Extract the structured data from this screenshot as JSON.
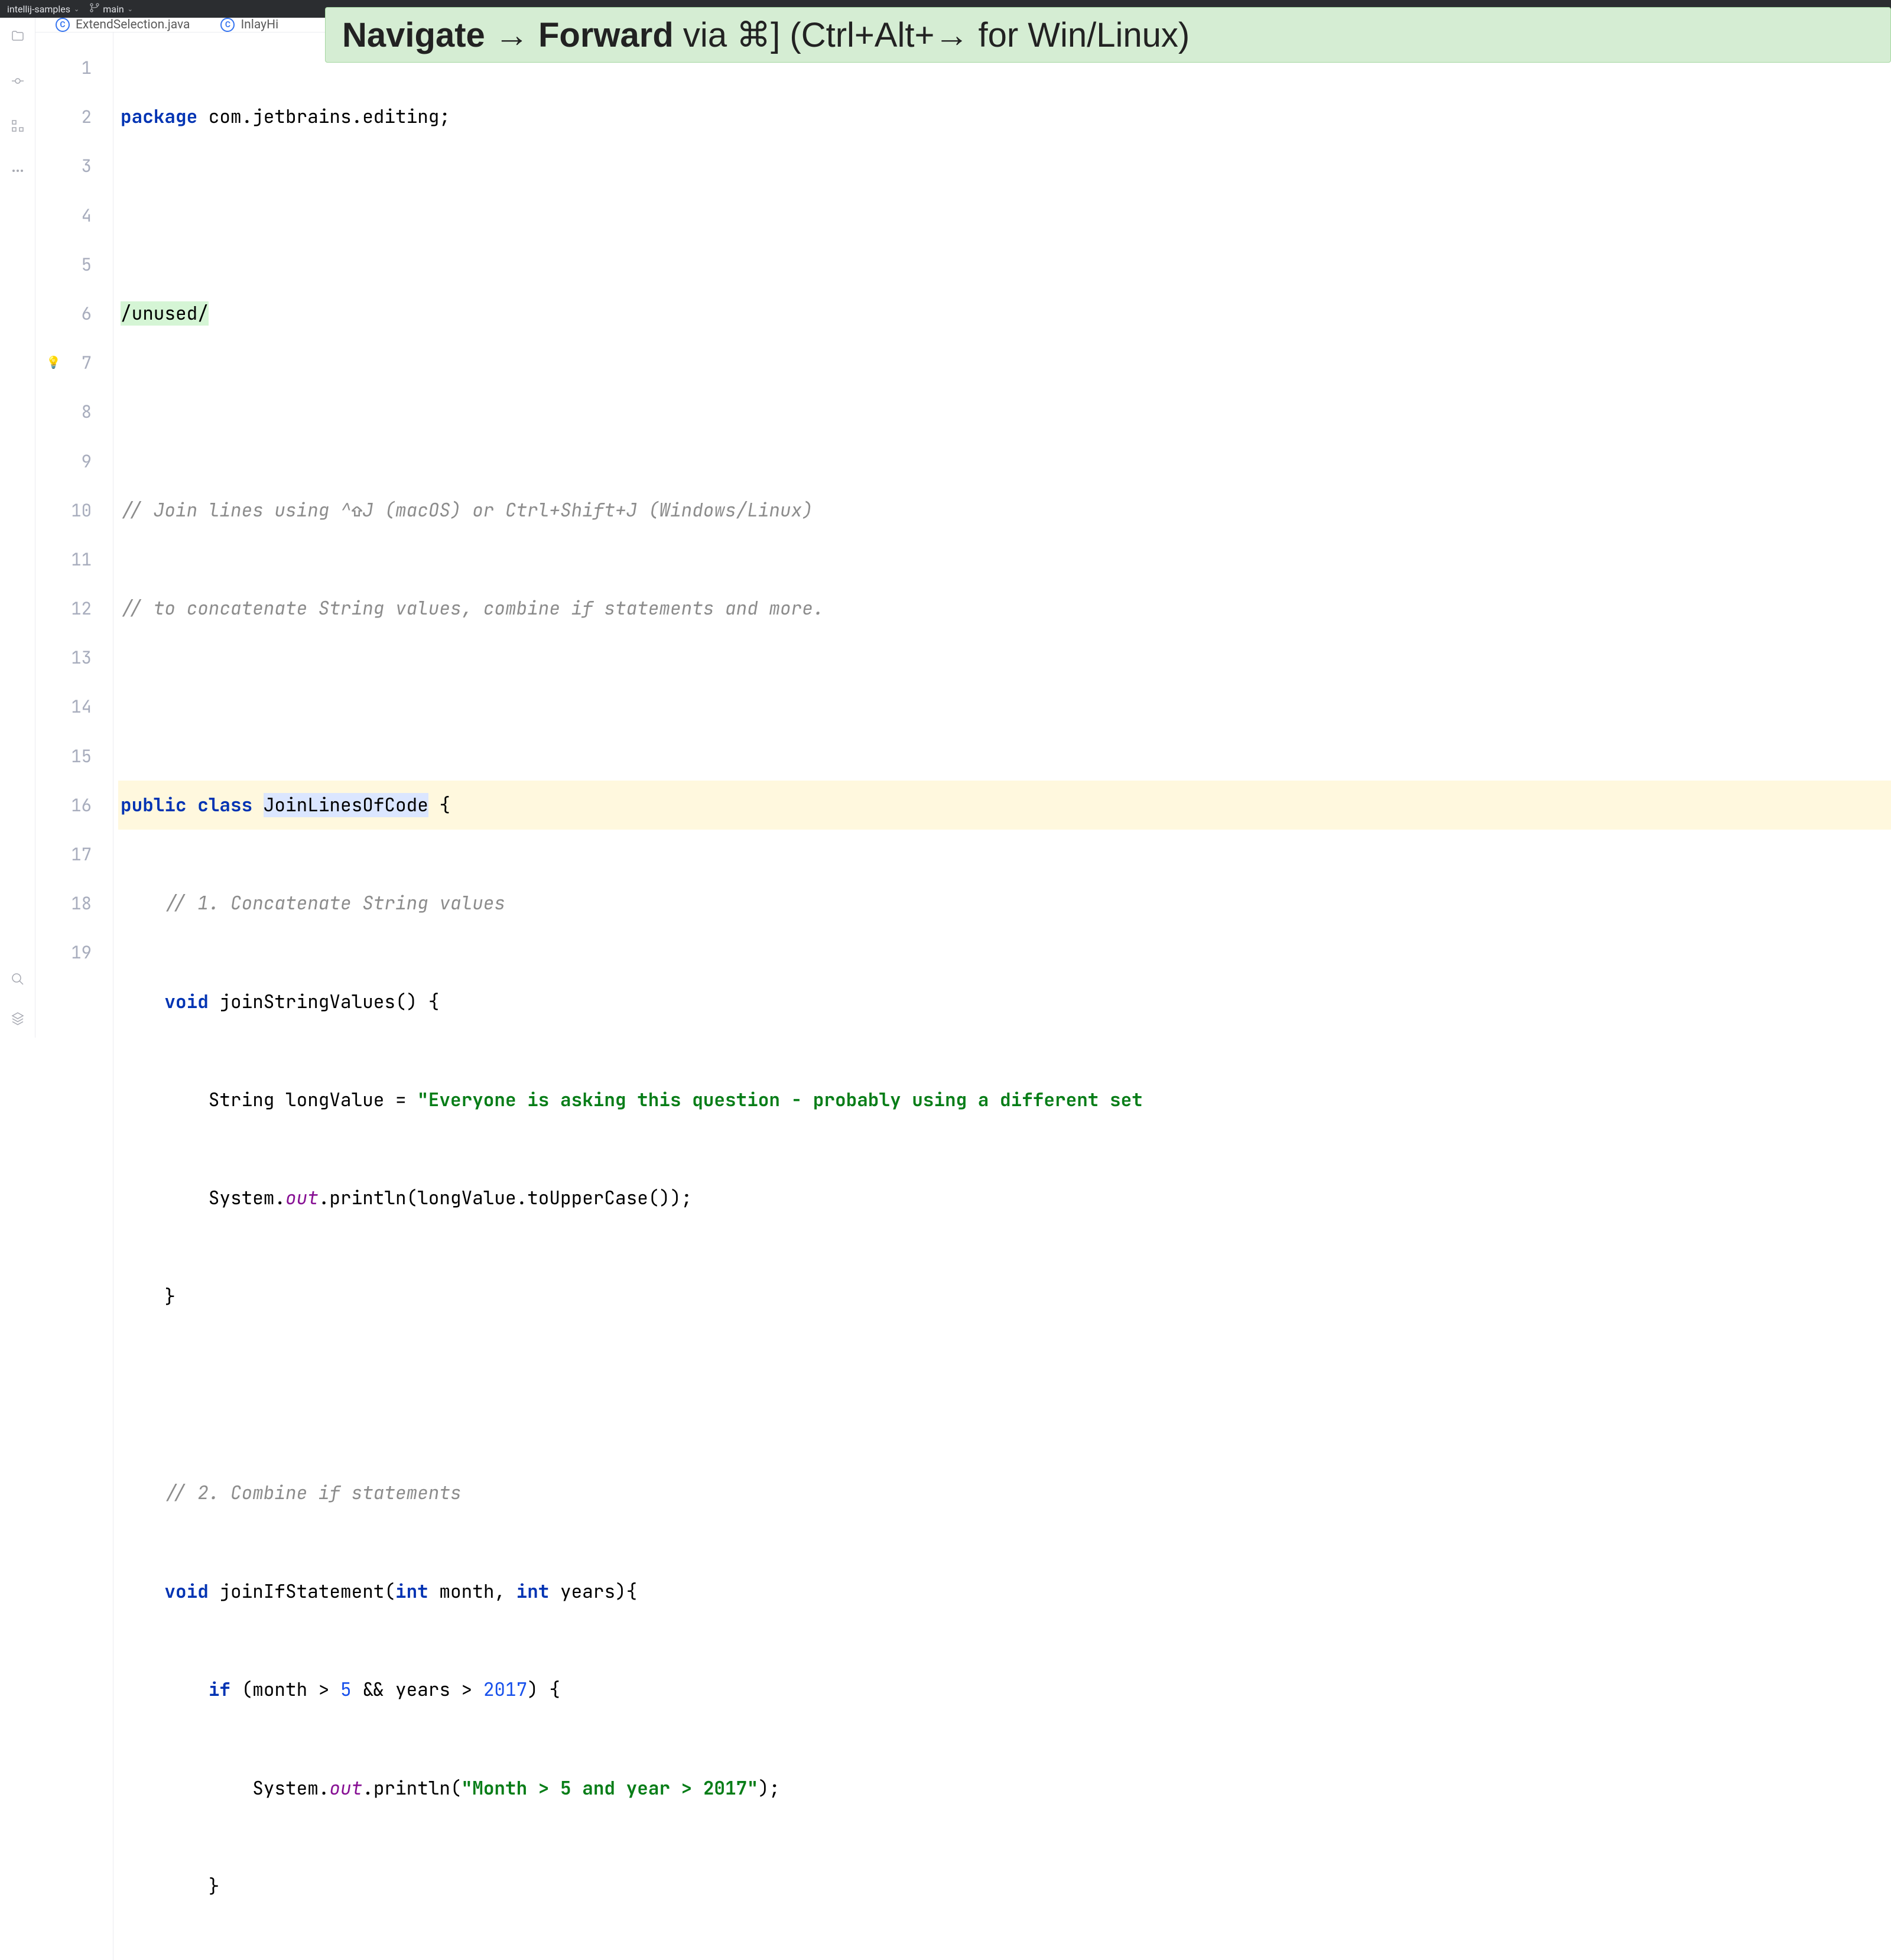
{
  "topbar": {
    "project": "intellij-samples",
    "branch": "main"
  },
  "tip": {
    "bold": "Navigate → Forward",
    "rest": " via ⌘] (Ctrl+Alt+→ for Win/Linux)"
  },
  "tabs": [
    {
      "label": "ExtendSelection.java"
    },
    {
      "label": "InlayHi"
    }
  ],
  "lines": [
    1,
    2,
    3,
    4,
    5,
    6,
    7,
    8,
    9,
    10,
    11,
    12,
    13,
    14,
    15,
    16,
    17,
    18,
    19
  ],
  "code": {
    "l1_kw": "package",
    "l1_rest": " com.jetbrains.editing;",
    "l3": "/unused/",
    "l5": "// Join lines using ^⇧J (macOS) or Ctrl+Shift+J (Windows/Linux)",
    "l6": "// to concatenate String values, combine if statements and more.",
    "l8_public": "public",
    "l8_class": "class",
    "l8_name": "JoinLinesOfCode",
    "l8_brace": " {",
    "l9": "    // 1. Concatenate String values",
    "l10_void": "void",
    "l10_rest": " joinStringValues() {",
    "l11_pre": "        String longValue = ",
    "l11_str": "\"Everyone is asking this question - probably using a different set",
    "l12_pre": "        System.",
    "l12_out": "out",
    "l12_rest": ".println(longValue.toUpperCase());",
    "l13": "    }",
    "l15": "    // 2. Combine if statements",
    "l16_void": "void",
    "l16_mid": " joinIfStatement(",
    "l16_int1": "int",
    "l16_p1": " month, ",
    "l16_int2": "int",
    "l16_p2": " years){",
    "l17_pre": "        ",
    "l17_if": "if",
    "l17_mid": " (month > ",
    "l17_n1": "5",
    "l17_and": " && years > ",
    "l17_n2": "2017",
    "l17_end": ") {",
    "l18_pre": "            System.",
    "l18_out": "out",
    "l18_mid": ".println(",
    "l18_str": "\"Month > 5 and year > 2017\"",
    "l18_end": ");",
    "l19": "        }"
  },
  "icons": {
    "folder": "folder",
    "commit": "commit",
    "structure": "structure",
    "more": "more",
    "search": "search",
    "layers": "layers",
    "bulb": "💡"
  }
}
